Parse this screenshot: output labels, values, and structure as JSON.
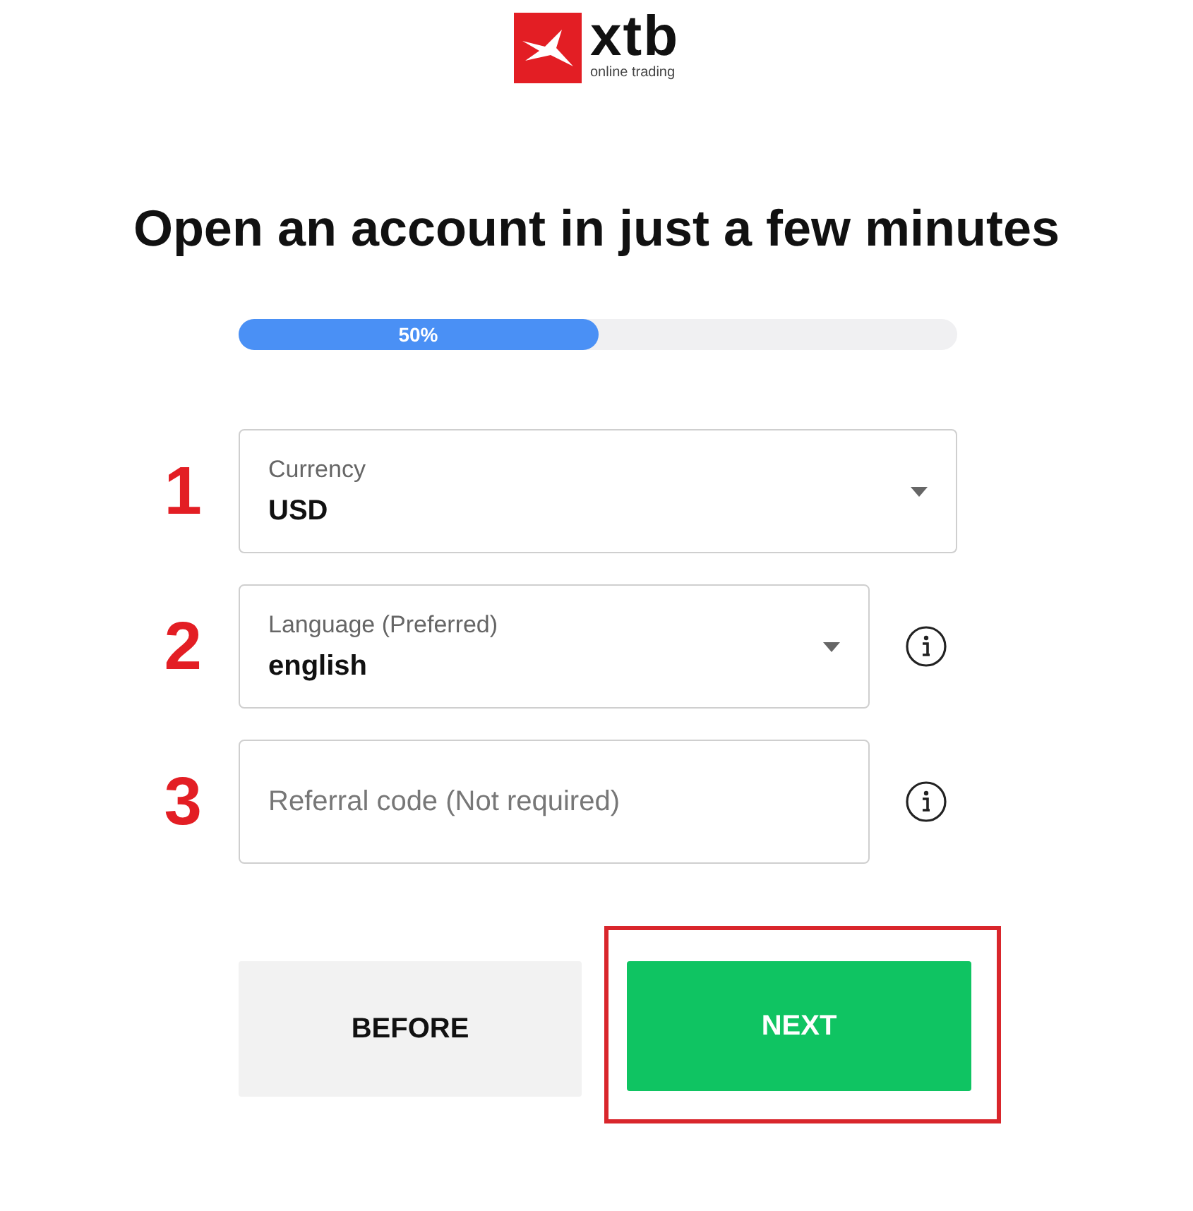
{
  "logo": {
    "name": "xtb",
    "tagline": "online trading"
  },
  "title": "Open an account in just a few minutes",
  "progress": {
    "level": 0.5,
    "label": "50%"
  },
  "fields": [
    {
      "number": "1",
      "kind": "select",
      "label": "Currency",
      "value": "USD",
      "info": false
    },
    {
      "number": "2",
      "kind": "select",
      "label": "Language (Preferred)",
      "value": "english",
      "info": true
    },
    {
      "number": "3",
      "kind": "text",
      "placeholder": "Referral code (Not required)",
      "info": true
    }
  ],
  "buttons": [
    {
      "label": "BEFORE",
      "kind": "secondary",
      "highlighted": false
    },
    {
      "label": "NEXT",
      "kind": "primary",
      "highlighted": true
    }
  ]
}
